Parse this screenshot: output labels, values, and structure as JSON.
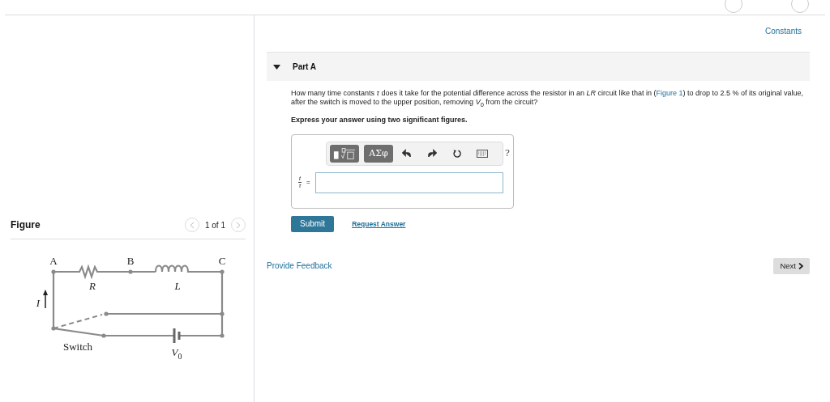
{
  "figure_panel": {
    "title": "Figure",
    "counter": "1 of 1",
    "circuit": {
      "node_labels": [
        "A",
        "B",
        "C"
      ],
      "resistor_label": "R",
      "inductor_label": "L",
      "current_label": "I",
      "switch_label": "Switch",
      "source_label": "V",
      "source_subscript": "0"
    }
  },
  "constants_link": "Constants",
  "part": {
    "title": "Part A",
    "expanded": true,
    "question_before": "How many time constants *τ* does it take for the potential difference across the resistor in an *LR* circuit like that in (",
    "figure_link": "Figure 1",
    "question_after": ") to drop to 2.5 % of its original value, after the switch is moved to the upper position, removing *V*$_{0}$ from the circuit?",
    "instruction": "Express your answer using two significant figures.",
    "toolbar": [
      {
        "kind": "templates"
      },
      {
        "kind": "text",
        "label": "ΑΣφ"
      },
      {
        "kind": "undo"
      },
      {
        "kind": "redo"
      },
      {
        "kind": "reset"
      },
      {
        "kind": "keyboard"
      },
      {
        "kind": "plain",
        "label": "?"
      }
    ],
    "answer_label": {
      "numerator": "t",
      "denominator": "τ",
      "equals": "="
    },
    "submit": "Submit",
    "request_answer": "Request Answer"
  },
  "feedback_link": "Provide Feedback",
  "next_button": "Next"
}
